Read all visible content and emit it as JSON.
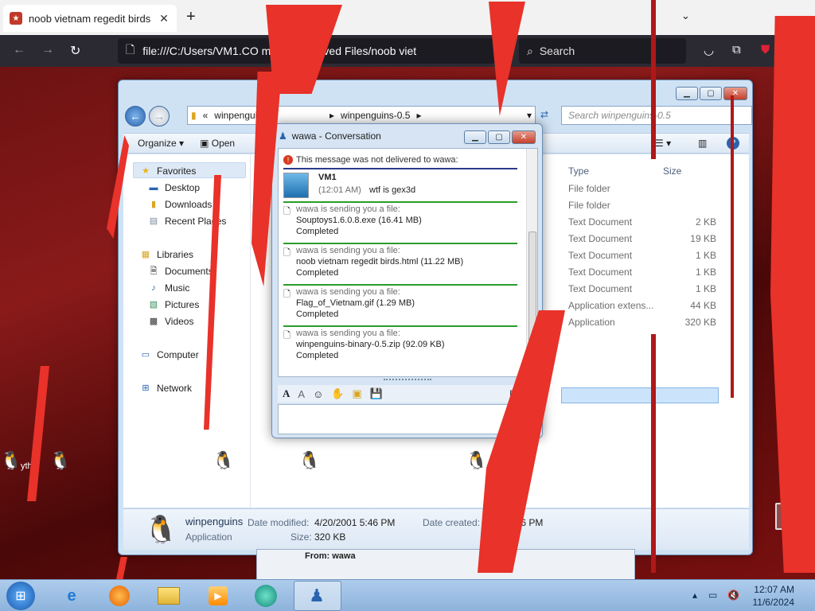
{
  "browser": {
    "tab_title": "noob vietnam regedit birds",
    "url": "file:///C:/Users/VM1.CO          ments/Received Files/noob viet",
    "search_placeholder": "Search"
  },
  "explorer": {
    "address_prefix": "«",
    "address_segment_1": "winpenguins",
    "address_segment_2": "winpenguins-0.5",
    "search_placeholder": "Search winpenguins-0.5",
    "toolbar": {
      "organize": "Organize ▾",
      "open": "Open"
    },
    "nav": {
      "favorites": "Favorites",
      "desktop": "Desktop",
      "downloads": "Downloads",
      "recent": "Recent Places",
      "libraries": "Libraries",
      "documents": "Documents",
      "music": "Music",
      "pictures": "Pictures",
      "videos": "Videos",
      "computer": "Computer",
      "network": "Network"
    },
    "columns": {
      "type": "Type",
      "size": "Size"
    },
    "rows": [
      {
        "type": "File folder",
        "size": ""
      },
      {
        "type": "File folder",
        "size": ""
      },
      {
        "type": "Text Document",
        "size": "2 KB"
      },
      {
        "type": "Text Document",
        "size": "19 KB"
      },
      {
        "type": "Text Document",
        "size": "1 KB"
      },
      {
        "type": "Text Document",
        "size": "1 KB"
      },
      {
        "type": "Text Document",
        "size": "1 KB"
      },
      {
        "type": "Application extens...",
        "size": "44 KB"
      },
      {
        "type": "Application",
        "size": "320 KB"
      }
    ],
    "details": {
      "name": "winpenguins",
      "kind": "Application",
      "modified_label": "Date modified:",
      "modified_value": "4/20/2001 5:46 PM",
      "size_label": "Size:",
      "size_value": "320 KB",
      "created_label": "Date created:",
      "created_value": "4         46 PM"
    }
  },
  "conversation": {
    "title": "wawa - Conversation",
    "error": "This message was not delivered to wawa:",
    "sender": "VM1",
    "sender_time": "(12:01 AM)",
    "sender_text": "wtf is gex3d",
    "transfers": [
      {
        "header": "wawa is sending you a file:",
        "file": "Souptoys1.6.0.8.exe (16.41 MB)",
        "status": "Completed"
      },
      {
        "header": "wawa is sending you a file:",
        "file": "noob vietnam regedit birds.html (11.22 MB)",
        "status": "Completed"
      },
      {
        "header": "wawa is sending you a file:",
        "file": "Flag_of_Vietnam.gif (1.29 MB)",
        "status": "Completed"
      },
      {
        "header": "wawa is sending you a file:",
        "file": "winpenguins-binary-0.5.zip (92.09 KB)",
        "status": "Completed"
      }
    ]
  },
  "behind_window": {
    "from": "From: wawa"
  },
  "desktop": {
    "recycle_label": "e Bin",
    "left_label": "ythi"
  },
  "taskbar": {
    "time": "12:07 AM",
    "date": "11/6/2024"
  }
}
